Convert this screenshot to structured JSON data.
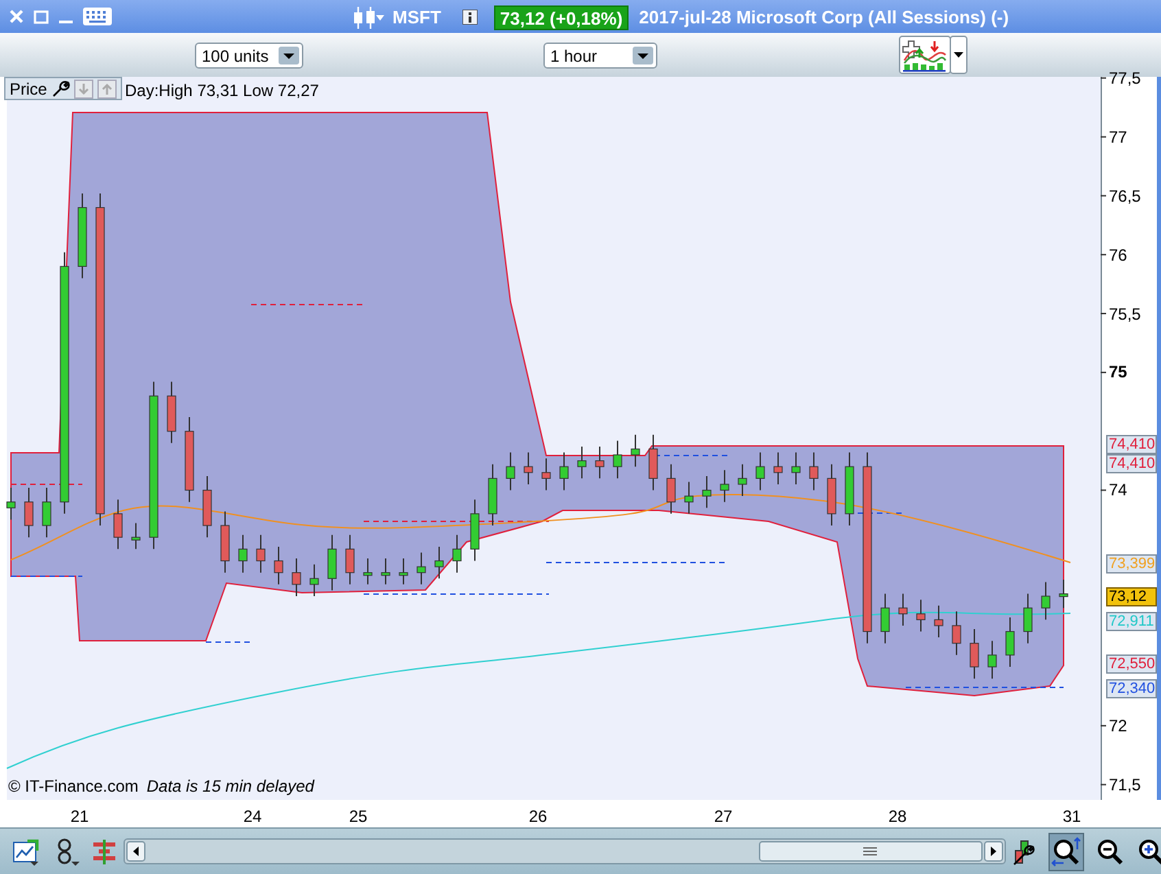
{
  "title_bar": {
    "symbol": "MSFT",
    "quote": "73,12 (+0,18%)",
    "description": "2017-jul-28 Microsoft Corp (All Sessions) (-)"
  },
  "toolbar": {
    "quantity": "100 units",
    "interval": "1 hour"
  },
  "chart_panel": {
    "label": "Price",
    "day_range": "Day:High 73,31 Low 72,27",
    "copyright": "© IT-Finance.com",
    "delay_note": "Data is 15 min delayed",
    "chart_data": {
      "type": "candlestick",
      "ylim": [
        71.37,
        77.51
      ],
      "categories": [
        null,
        null,
        null,
        null,
        null,
        null,
        null,
        null,
        null,
        null,
        null,
        null,
        null,
        null,
        null,
        null,
        null,
        null,
        null,
        null,
        null,
        null,
        null,
        null,
        null,
        null,
        null,
        null,
        null,
        null,
        null,
        null,
        null,
        null,
        null,
        null,
        null,
        null,
        null,
        null,
        null,
        null,
        null,
        null,
        null,
        null,
        null,
        null,
        null,
        null,
        null,
        null,
        null,
        null,
        null,
        null,
        null,
        null,
        null,
        null
      ],
      "ohlc": [
        [
          73.85,
          74.02,
          73.75,
          73.9
        ],
        [
          73.9,
          74.02,
          73.6,
          73.7
        ],
        [
          73.7,
          74.02,
          73.6,
          73.9
        ],
        [
          73.9,
          76.02,
          73.8,
          75.9
        ],
        [
          75.9,
          76.52,
          75.8,
          76.4
        ],
        [
          76.4,
          76.52,
          73.7,
          73.8
        ],
        [
          73.8,
          73.92,
          73.5,
          73.6
        ],
        [
          73.6,
          73.72,
          73.5,
          73.6
        ],
        [
          73.6,
          74.92,
          73.5,
          74.8
        ],
        [
          74.8,
          74.92,
          74.4,
          74.5
        ],
        [
          74.5,
          74.62,
          73.9,
          74.0
        ],
        [
          74.0,
          74.12,
          73.6,
          73.7
        ],
        [
          73.7,
          73.82,
          73.3,
          73.4
        ],
        [
          73.4,
          73.62,
          73.3,
          73.5
        ],
        [
          73.5,
          73.62,
          73.3,
          73.4
        ],
        [
          73.4,
          73.52,
          73.2,
          73.3
        ],
        [
          73.3,
          73.42,
          73.1,
          73.2
        ],
        [
          73.2,
          73.37,
          73.1,
          73.25
        ],
        [
          73.25,
          73.62,
          73.15,
          73.5
        ],
        [
          73.5,
          73.62,
          73.2,
          73.3
        ],
        [
          73.3,
          73.42,
          73.2,
          73.3
        ],
        [
          73.3,
          73.42,
          73.2,
          73.3
        ],
        [
          73.3,
          73.42,
          73.2,
          73.3
        ],
        [
          73.3,
          73.47,
          73.2,
          73.35
        ],
        [
          73.35,
          73.52,
          73.25,
          73.4
        ],
        [
          73.4,
          73.62,
          73.3,
          73.5
        ],
        [
          73.5,
          73.92,
          73.4,
          73.8
        ],
        [
          73.8,
          74.22,
          73.7,
          74.1
        ],
        [
          74.1,
          74.32,
          74.0,
          74.2
        ],
        [
          74.2,
          74.32,
          74.05,
          74.15
        ],
        [
          74.15,
          74.27,
          74.0,
          74.1
        ],
        [
          74.1,
          74.32,
          74.0,
          74.2
        ],
        [
          74.2,
          74.37,
          74.1,
          74.25
        ],
        [
          74.25,
          74.37,
          74.1,
          74.2
        ],
        [
          74.2,
          74.42,
          74.1,
          74.3
        ],
        [
          74.3,
          74.47,
          74.2,
          74.35
        ],
        [
          74.35,
          74.47,
          74.0,
          74.1
        ],
        [
          74.1,
          74.22,
          73.8,
          73.9
        ],
        [
          73.9,
          74.07,
          73.8,
          73.95
        ],
        [
          73.95,
          74.12,
          73.85,
          74.0
        ],
        [
          74.0,
          74.17,
          73.9,
          74.05
        ],
        [
          74.05,
          74.22,
          73.95,
          74.1
        ],
        [
          74.1,
          74.32,
          74.0,
          74.2
        ],
        [
          74.2,
          74.32,
          74.05,
          74.15
        ],
        [
          74.15,
          74.32,
          74.05,
          74.2
        ],
        [
          74.2,
          74.32,
          74.0,
          74.1
        ],
        [
          74.1,
          74.22,
          73.7,
          73.8
        ],
        [
          73.8,
          74.32,
          73.7,
          74.2
        ],
        [
          74.2,
          74.32,
          72.7,
          72.8
        ],
        [
          72.8,
          73.12,
          72.7,
          73.0
        ],
        [
          73.0,
          73.12,
          72.85,
          72.95
        ],
        [
          72.95,
          73.07,
          72.8,
          72.9
        ],
        [
          72.9,
          73.02,
          72.75,
          72.85
        ],
        [
          72.85,
          72.97,
          72.6,
          72.7
        ],
        [
          72.7,
          72.82,
          72.4,
          72.5
        ],
        [
          72.5,
          72.72,
          72.4,
          72.6
        ],
        [
          72.6,
          72.92,
          72.5,
          72.8
        ],
        [
          72.8,
          73.12,
          72.7,
          73.0
        ],
        [
          73.0,
          73.22,
          72.9,
          73.1
        ],
        [
          73.1,
          73.24,
          73.0,
          73.12
        ]
      ],
      "yticks": [
        {
          "value": 71.5,
          "label": "71,5"
        },
        {
          "value": 72,
          "label": "72"
        },
        {
          "value": 74,
          "label": "74"
        },
        {
          "value": 75,
          "label": "75"
        },
        {
          "value": 75.5,
          "label": "75,5"
        },
        {
          "value": 76,
          "label": "76"
        },
        {
          "value": 76.5,
          "label": "76,5"
        },
        {
          "value": 77,
          "label": "77"
        },
        {
          "value": 77.5,
          "label": "77,5"
        }
      ]
    },
    "date_labels": [
      "21",
      "24",
      "25",
      "26",
      "27",
      "28",
      "31"
    ],
    "price_tags": [
      {
        "text": "74,410",
        "color": "#e0203c",
        "kind": "level"
      },
      {
        "text": "74,410",
        "color": "#e0203c",
        "kind": "level"
      },
      {
        "text": "73,399",
        "color": "#f0a020",
        "kind": "level"
      },
      {
        "text": "73,12",
        "color": "#f2c20c",
        "kind": "current"
      },
      {
        "text": "72,911",
        "color": "#20c8c8",
        "kind": "level"
      },
      {
        "text": "72,550",
        "color": "#e0203c",
        "kind": "level"
      },
      {
        "text": "72,340",
        "color": "#2050e0",
        "kind": "level"
      }
    ]
  },
  "bottom_toolbar": {
    "zoom_tool": {
      "selected": true
    }
  }
}
